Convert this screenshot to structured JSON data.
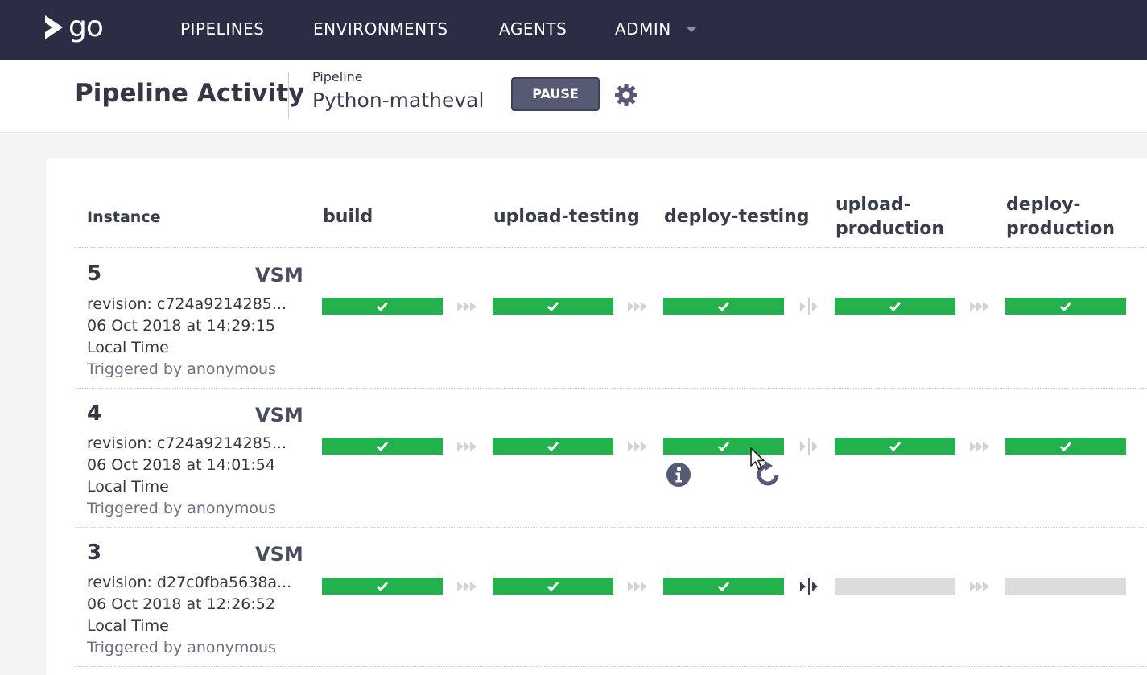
{
  "nav": {
    "logo_text": "go",
    "items": [
      "PIPELINES",
      "ENVIRONMENTS",
      "AGENTS",
      "ADMIN"
    ]
  },
  "header": {
    "title": "Pipeline Activity",
    "pipeline_label": "Pipeline",
    "pipeline_name": "Python-matheval",
    "pause_label": "PAUSE"
  },
  "columns": {
    "instance": "Instance",
    "stages": [
      "build",
      "upload-testing",
      "deploy-testing",
      "upload-\nproduction",
      "deploy-\nproduction"
    ]
  },
  "instances": [
    {
      "number": "5",
      "vsm": "VSM",
      "revision": "revision: c724a9214285...",
      "date": "06 Oct 2018 at 14:29:15",
      "tz": "Local Time",
      "triggered": "Triggered by anonymous",
      "stages": [
        "passed",
        "passed",
        "passed",
        "passed",
        "passed"
      ]
    },
    {
      "number": "4",
      "vsm": "VSM",
      "revision": "revision: c724a9214285...",
      "date": "06 Oct 2018 at 14:01:54",
      "tz": "Local Time",
      "triggered": "Triggered by anonymous",
      "stages": [
        "passed",
        "passed",
        "passed",
        "passed",
        "passed"
      ]
    },
    {
      "number": "3",
      "vsm": "VSM",
      "revision": "revision: d27c0fba5638a...",
      "date": "06 Oct 2018 at 12:26:52",
      "tz": "Local Time",
      "triggered": "Triggered by anonymous",
      "stages": [
        "passed",
        "passed",
        "passed",
        "pending",
        "pending"
      ]
    }
  ],
  "colors": {
    "nav_bg": "#2b2d45",
    "passed": "#22b14c",
    "pending": "#dcdcdc",
    "pause_bg": "#565b73"
  },
  "icons": [
    "logo-icon",
    "caret-down-icon",
    "gear-icon",
    "check-icon",
    "auto-arrow-icon",
    "manual-gate-icon",
    "info-icon",
    "rerun-icon",
    "mouse-cursor-icon"
  ]
}
